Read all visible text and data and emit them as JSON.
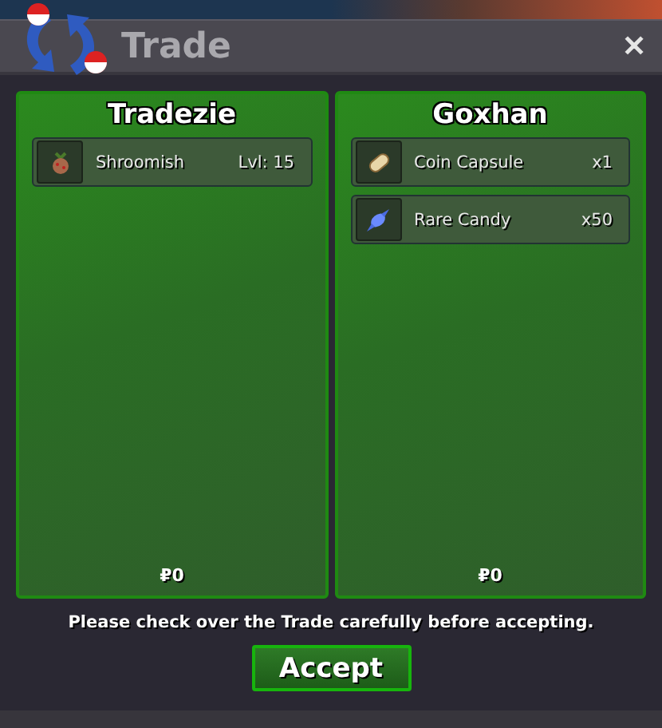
{
  "window": {
    "title": "Trade",
    "close": "✕"
  },
  "players": [
    {
      "name": "Tradezie",
      "items": [
        {
          "kind": "pokemon",
          "name": "Shroomish",
          "detail": "Lvl: 15"
        }
      ],
      "money": "₽0"
    },
    {
      "name": "Goxhan",
      "items": [
        {
          "kind": "capsule",
          "name": "Coin Capsule",
          "detail": "x1"
        },
        {
          "kind": "candy",
          "name": "Rare Candy",
          "detail": "x50"
        }
      ],
      "money": "₽0"
    }
  ],
  "notice": "Please check over the Trade carefully before accepting.",
  "accept_button": "Accept"
}
